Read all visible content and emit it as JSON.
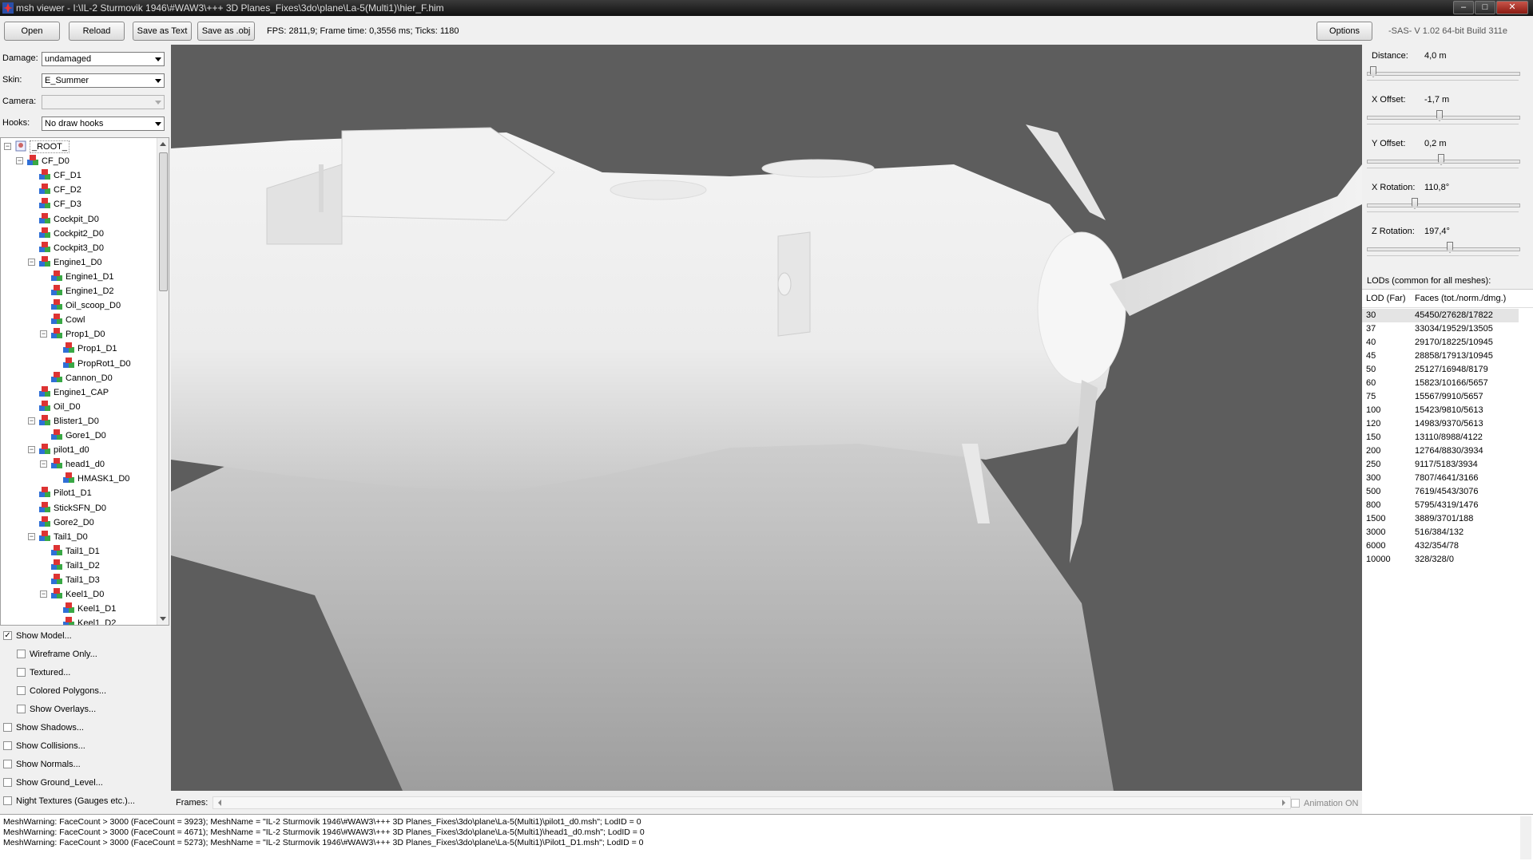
{
  "window": {
    "title": "msh viewer - I:\\IL-2 Sturmovik 1946\\#WAW3\\+++ 3D Planes_Fixes\\3do\\plane\\La-5(Multi1)\\hier_F.him",
    "minimize": "–",
    "maximize": "□",
    "close": "✕"
  },
  "toolbar": {
    "open": "Open",
    "reload": "Reload",
    "save_text": "Save as Text",
    "save_obj": "Save as .obj",
    "stats": "FPS: 2811,9; Frame time: 0,3556 ms; Ticks: 1180",
    "options": "Options",
    "version": "-SAS- V 1.02  64-bit  Build 311e"
  },
  "controls": {
    "damage_label": "Damage:",
    "damage_value": "undamaged",
    "skin_label": "Skin:",
    "skin_value": "E_Summer",
    "camera_label": "Camera:",
    "camera_value": "",
    "hooks_label": "Hooks:",
    "hooks_value": "No draw hooks"
  },
  "tree": [
    {
      "label": "_ROOT_",
      "level": 0,
      "expander": "−",
      "root": true
    },
    {
      "label": "CF_D0",
      "level": 1,
      "expander": "−"
    },
    {
      "label": "CF_D1",
      "level": 2
    },
    {
      "label": "CF_D2",
      "level": 2
    },
    {
      "label": "CF_D3",
      "level": 2
    },
    {
      "label": "Cockpit_D0",
      "level": 2
    },
    {
      "label": "Cockpit2_D0",
      "level": 2
    },
    {
      "label": "Cockpit3_D0",
      "level": 2
    },
    {
      "label": "Engine1_D0",
      "level": 2,
      "expander": "−"
    },
    {
      "label": "Engine1_D1",
      "level": 3
    },
    {
      "label": "Engine1_D2",
      "level": 3
    },
    {
      "label": "Oil_scoop_D0",
      "level": 3
    },
    {
      "label": "Cowl",
      "level": 3
    },
    {
      "label": "Prop1_D0",
      "level": 3,
      "expander": "−"
    },
    {
      "label": "Prop1_D1",
      "level": 4
    },
    {
      "label": "PropRot1_D0",
      "level": 4
    },
    {
      "label": "Cannon_D0",
      "level": 3
    },
    {
      "label": "Engine1_CAP",
      "level": 2
    },
    {
      "label": "Oil_D0",
      "level": 2
    },
    {
      "label": "Blister1_D0",
      "level": 2,
      "expander": "−"
    },
    {
      "label": "Gore1_D0",
      "level": 3
    },
    {
      "label": "pilot1_d0",
      "level": 2,
      "expander": "−"
    },
    {
      "label": "head1_d0",
      "level": 3,
      "expander": "−"
    },
    {
      "label": "HMASK1_D0",
      "level": 4
    },
    {
      "label": "Pilot1_D1",
      "level": 2
    },
    {
      "label": "StickSFN_D0",
      "level": 2
    },
    {
      "label": "Gore2_D0",
      "level": 2
    },
    {
      "label": "Tail1_D0",
      "level": 2,
      "expander": "−"
    },
    {
      "label": "Tail1_D1",
      "level": 3
    },
    {
      "label": "Tail1_D2",
      "level": 3
    },
    {
      "label": "Tail1_D3",
      "level": 3
    },
    {
      "label": "Keel1_D0",
      "level": 3,
      "expander": "−"
    },
    {
      "label": "Keel1_D1",
      "level": 4
    },
    {
      "label": "Keel1_D2",
      "level": 4
    }
  ],
  "checks": [
    {
      "label": "Show Model...",
      "checked": true,
      "level": 0
    },
    {
      "label": "Wireframe Only...",
      "checked": false,
      "level": 1
    },
    {
      "label": "Textured...",
      "checked": false,
      "level": 1
    },
    {
      "label": "Colored Polygons...",
      "checked": false,
      "level": 1
    },
    {
      "label": "Show Overlays...",
      "checked": false,
      "level": 1
    },
    {
      "label": "Show Shadows...",
      "checked": false,
      "level": 0
    },
    {
      "label": "Show Collisions...",
      "checked": false,
      "level": 0
    },
    {
      "label": "Show Normals...",
      "checked": false,
      "level": 0
    },
    {
      "label": "Show Ground_Level...",
      "checked": false,
      "level": 0
    },
    {
      "label": "Night Textures (Gauges etc.)...",
      "checked": false,
      "level": 0
    }
  ],
  "frames": {
    "label": "Frames:",
    "animation_label": "Animation ON",
    "animation_on": false
  },
  "sliders": [
    {
      "label": "Distance:",
      "value": "4,0 m",
      "level": 0.02
    },
    {
      "label": "X Offset:",
      "value": "-1,7 m",
      "level": 0.48
    },
    {
      "label": "Y Offset:",
      "value": "0,2 m",
      "level": 0.49
    },
    {
      "label": "X Rotation:",
      "value": "110,8°",
      "level": 0.31
    },
    {
      "label": "Z Rotation:",
      "value": "197,4°",
      "level": 0.55
    }
  ],
  "lods": {
    "title": "LODs (common for all meshes):",
    "col_lod": "LOD (Far)",
    "col_faces": "Faces (tot./norm./dmg.)",
    "rows": [
      {
        "lod": "30",
        "faces": "45450/27628/17822",
        "selected": true
      },
      {
        "lod": "37",
        "faces": "33034/19529/13505"
      },
      {
        "lod": "40",
        "faces": "29170/18225/10945"
      },
      {
        "lod": "45",
        "faces": "28858/17913/10945"
      },
      {
        "lod": "50",
        "faces": "25127/16948/8179"
      },
      {
        "lod": "60",
        "faces": "15823/10166/5657"
      },
      {
        "lod": "75",
        "faces": "15567/9910/5657"
      },
      {
        "lod": "100",
        "faces": "15423/9810/5613"
      },
      {
        "lod": "120",
        "faces": "14983/9370/5613"
      },
      {
        "lod": "150",
        "faces": "13110/8988/4122"
      },
      {
        "lod": "200",
        "faces": "12764/8830/3934"
      },
      {
        "lod": "250",
        "faces": "9117/5183/3934"
      },
      {
        "lod": "300",
        "faces": "7807/4641/3166"
      },
      {
        "lod": "500",
        "faces": "7619/4543/3076"
      },
      {
        "lod": "800",
        "faces": "5795/4319/1476"
      },
      {
        "lod": "1500",
        "faces": "3889/3701/188"
      },
      {
        "lod": "3000",
        "faces": "516/384/132"
      },
      {
        "lod": "6000",
        "faces": "432/354/78"
      },
      {
        "lod": "10000",
        "faces": "328/328/0"
      }
    ]
  },
  "log": [
    "MeshWarning: FaceCount > 3000 (FaceCount = 3923); MeshName = \"IL-2 Sturmovik 1946\\#WAW3\\+++ 3D Planes_Fixes\\3do\\plane\\La-5(Multi1)\\pilot1_d0.msh\"; LodID = 0",
    "MeshWarning: FaceCount > 3000 (FaceCount = 4671); MeshName = \"IL-2 Sturmovik 1946\\#WAW3\\+++ 3D Planes_Fixes\\3do\\plane\\La-5(Multi1)\\head1_d0.msh\"; LodID = 0",
    "MeshWarning: FaceCount > 3000 (FaceCount = 5273); MeshName = \"IL-2 Sturmovik 1946\\#WAW3\\+++ 3D Planes_Fixes\\3do\\plane\\La-5(Multi1)\\Pilot1_D1.msh\"; LodID = 0"
  ]
}
